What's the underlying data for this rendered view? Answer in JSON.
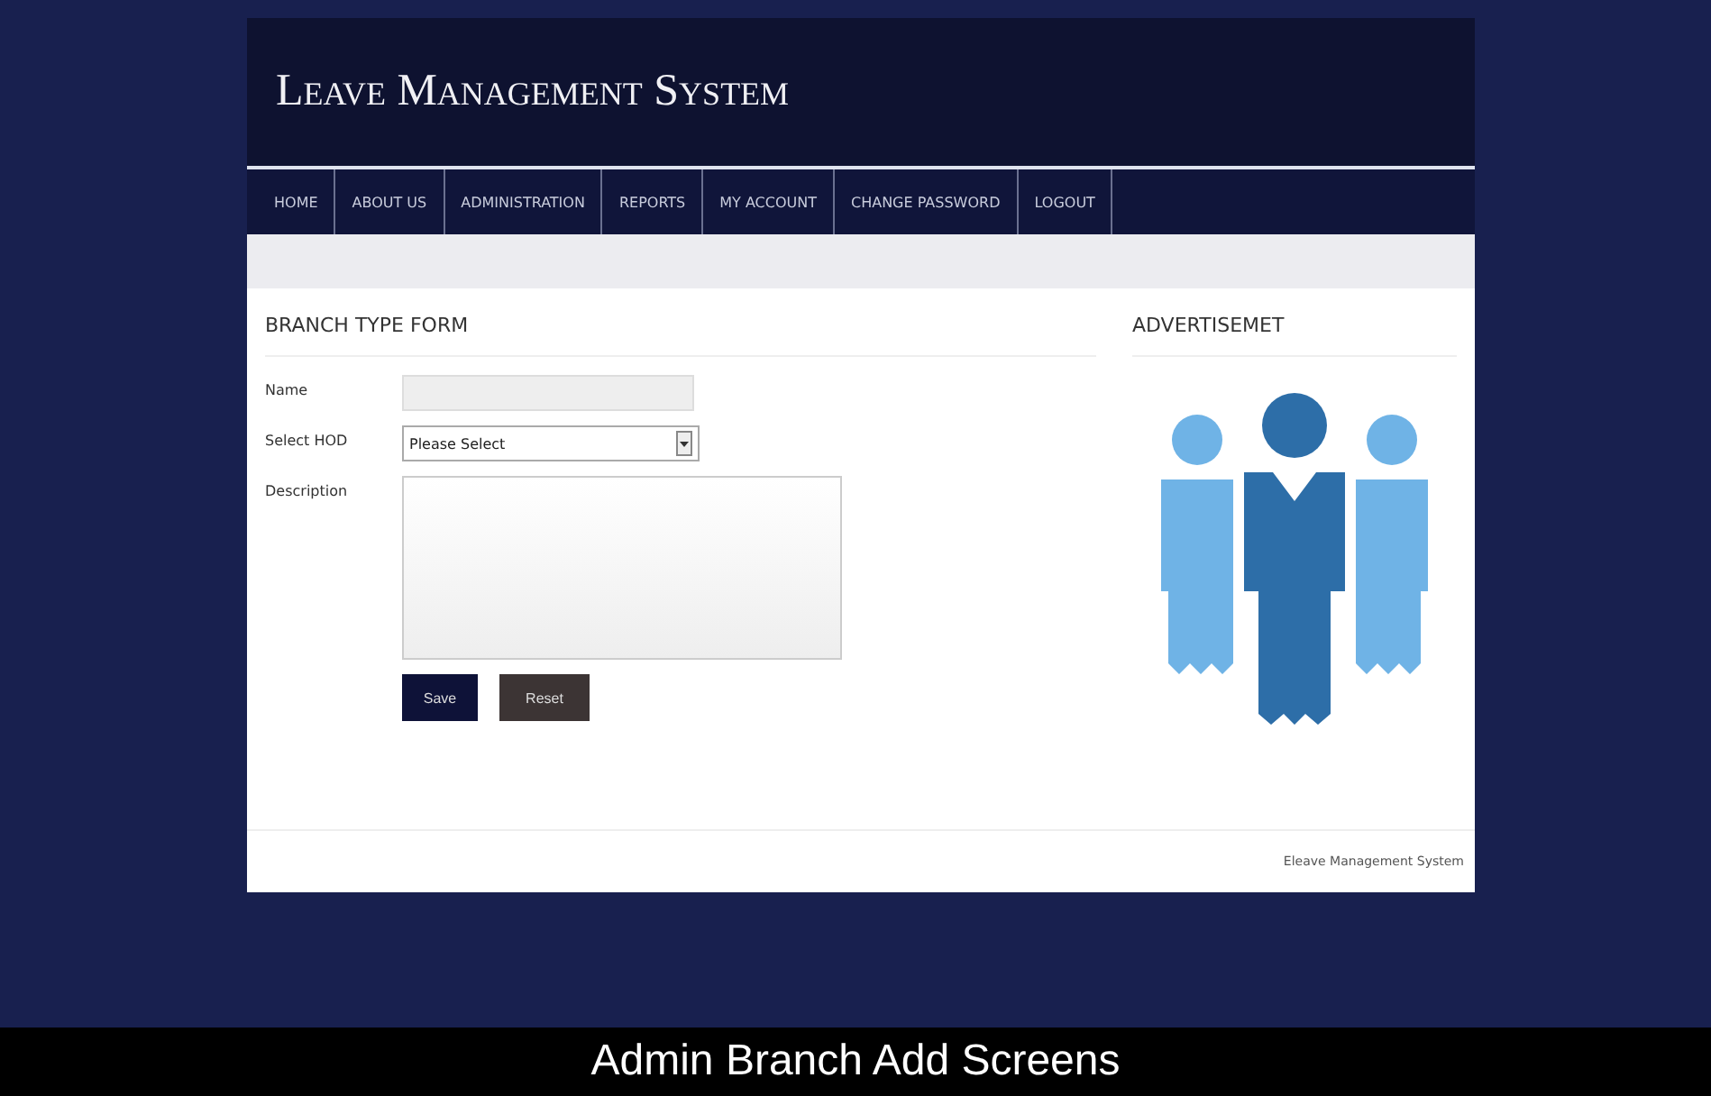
{
  "header": {
    "title": "Leave Management System"
  },
  "nav": [
    "HOME",
    "ABOUT US",
    "ADMINISTRATION",
    "REPORTS",
    "MY ACCOUNT",
    "CHANGE PASSWORD",
    "LOGOUT"
  ],
  "form": {
    "title": "BRANCH TYPE FORM",
    "fields": [
      {
        "kind": "text",
        "label": "Name"
      },
      {
        "kind": "select",
        "label": "Select HOD",
        "value": "Please Select"
      },
      {
        "kind": "textarea",
        "label": "Description"
      }
    ],
    "buttons": [
      {
        "label": "Save",
        "kind": "primary"
      },
      {
        "label": "Reset",
        "kind": "secondary"
      }
    ]
  },
  "sidebar": {
    "title": "ADVERTISEMET"
  },
  "footer": {
    "text": "Eleave Management System"
  },
  "caption": "Admin Branch Add Screens"
}
